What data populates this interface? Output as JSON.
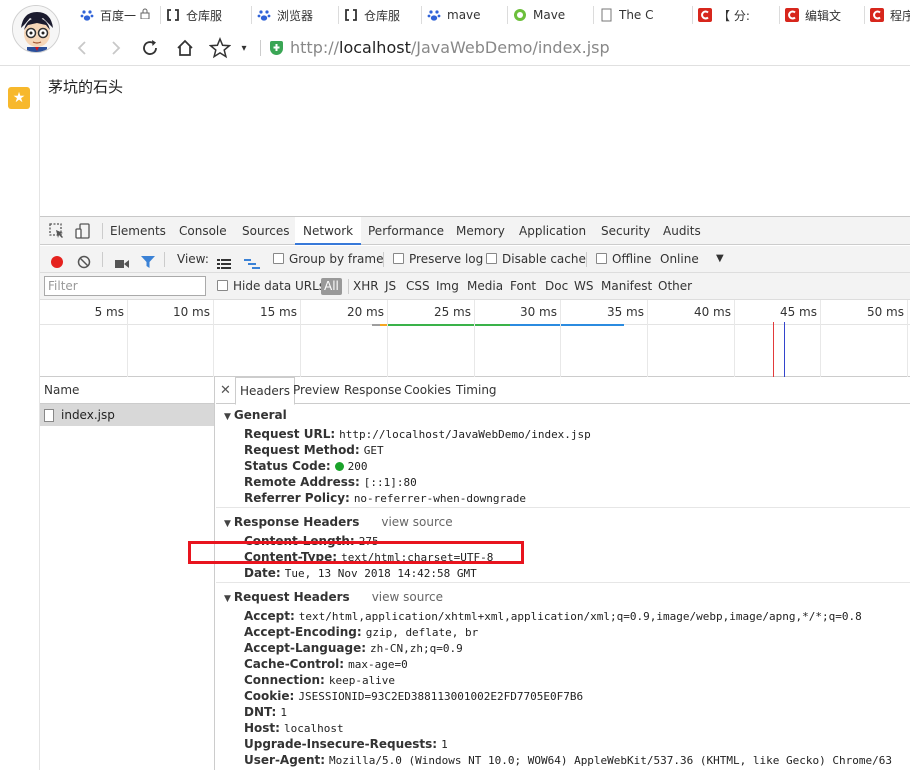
{
  "browser": {
    "tabs": [
      {
        "label": "百度一",
        "icon": "baidu-paw-icon",
        "locked": true
      },
      {
        "label": "仓库服",
        "icon": "code-brackets-icon"
      },
      {
        "label": "浏览器",
        "icon": "baidu-paw-icon"
      },
      {
        "label": "仓库服",
        "icon": "code-brackets-icon"
      },
      {
        "label": "mave",
        "icon": "baidu-paw-icon"
      },
      {
        "label": "Mave",
        "icon": "green-circle-icon"
      },
      {
        "label": "The C",
        "icon": "page-icon"
      },
      {
        "label": "【 分:",
        "icon": "csdn-c-icon"
      },
      {
        "label": "编辑文",
        "icon": "csdn-c-icon"
      },
      {
        "label": "程序",
        "icon": "csdn-c-icon"
      }
    ],
    "url_scheme": "http://",
    "url_host": "localhost",
    "url_path": "/JavaWebDemo/index.jsp"
  },
  "page": {
    "text": "茅坑的石头"
  },
  "devtools": {
    "panel_tabs": [
      "Elements",
      "Console",
      "Sources",
      "Network",
      "Performance",
      "Memory",
      "Application",
      "Security",
      "Audits"
    ],
    "active_panel": "Network",
    "toolbar": {
      "view_label": "View:",
      "group_by_frame": "Group by frame",
      "preserve_log": "Preserve log",
      "disable_cache": "Disable cache",
      "offline": "Offline",
      "throttle": "Online"
    },
    "filter": {
      "placeholder": "Filter",
      "hide_data_urls": "Hide data URLs",
      "types": [
        "All",
        "XHR",
        "JS",
        "CSS",
        "Img",
        "Media",
        "Font",
        "Doc",
        "WS",
        "Manifest",
        "Other"
      ]
    },
    "timeline_ticks": [
      "5 ms",
      "10 ms",
      "15 ms",
      "20 ms",
      "25 ms",
      "30 ms",
      "35 ms",
      "40 ms",
      "45 ms",
      "50 ms"
    ],
    "list_header": "Name",
    "requests": [
      "index.jsp"
    ],
    "detail_tabs": [
      "Headers",
      "Preview",
      "Response",
      "Cookies",
      "Timing"
    ],
    "general": {
      "title": "General",
      "items": [
        {
          "k": "Request URL:",
          "v": "http://localhost/JavaWebDemo/index.jsp"
        },
        {
          "k": "Request Method:",
          "v": "GET"
        },
        {
          "k": "Status Code:",
          "v": "200"
        },
        {
          "k": "Remote Address:",
          "v": "[::1]:80"
        },
        {
          "k": "Referrer Policy:",
          "v": "no-referrer-when-downgrade"
        }
      ]
    },
    "response_headers": {
      "title": "Response Headers",
      "view_source": "view source",
      "items": [
        {
          "k": "Content-Length:",
          "v": "275"
        },
        {
          "k": "Content-Type:",
          "v": "text/html;charset=UTF-8"
        },
        {
          "k": "Date:",
          "v": "Tue, 13 Nov 2018 14:42:58 GMT"
        }
      ]
    },
    "request_headers": {
      "title": "Request Headers",
      "view_source": "view source",
      "items": [
        {
          "k": "Accept:",
          "v": "text/html,application/xhtml+xml,application/xml;q=0.9,image/webp,image/apng,*/*;q=0.8"
        },
        {
          "k": "Accept-Encoding:",
          "v": "gzip, deflate, br"
        },
        {
          "k": "Accept-Language:",
          "v": "zh-CN,zh;q=0.9"
        },
        {
          "k": "Cache-Control:",
          "v": "max-age=0"
        },
        {
          "k": "Connection:",
          "v": "keep-alive"
        },
        {
          "k": "Cookie:",
          "v": "JSESSIONID=93C2ED388113001002E2FD7705E0F7B6"
        },
        {
          "k": "DNT:",
          "v": "1"
        },
        {
          "k": "Host:",
          "v": "localhost"
        },
        {
          "k": "Upgrade-Insecure-Requests:",
          "v": "1"
        },
        {
          "k": "User-Agent:",
          "v": "Mozilla/5.0 (Windows NT 10.0; WOW64) AppleWebKit/537.36 (KHTML, like Gecko) Chrome/63"
        }
      ]
    }
  },
  "colors": {
    "record_red": "#e5221e",
    "status_green": "#1aa32a",
    "highlight_red": "#e8141e",
    "active_tab_blue": "#3879d9"
  }
}
